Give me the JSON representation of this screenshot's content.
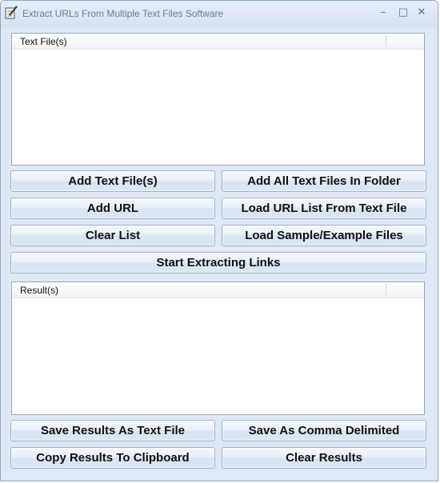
{
  "window": {
    "title": "Extract URLs From Multiple Text Files Software",
    "controls": {
      "minimize": "–",
      "maximize": "□",
      "close": "✕"
    }
  },
  "files_panel": {
    "header": "Text File(s)"
  },
  "buttons": {
    "add_text_files": "Add Text File(s)",
    "add_all_in_folder": "Add All Text Files In Folder",
    "add_url": "Add URL",
    "load_url_list": "Load URL List From Text File",
    "clear_list": "Clear List",
    "load_sample": "Load Sample/Example Files",
    "start_extracting": "Start Extracting Links",
    "save_as_text": "Save Results As Text File",
    "save_comma": "Save As Comma Delimited",
    "copy_clipboard": "Copy Results To Clipboard",
    "clear_results": "Clear Results"
  },
  "results_panel": {
    "header": "Result(s)"
  },
  "icons": {
    "app": "notepad-pencil-icon"
  }
}
